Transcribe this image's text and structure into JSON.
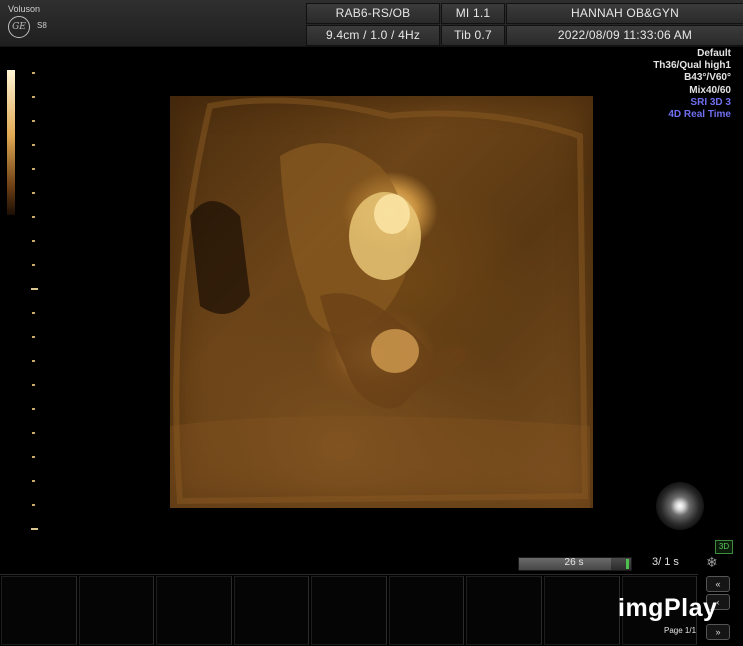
{
  "header": {
    "brand_name": "Voluson",
    "model": "S8",
    "logo_text": "GE",
    "probe": "RAB6-RS/OB",
    "mi": "MI  1.1",
    "institution": "HANNAH OB&GYN",
    "depth_freq": "9.4cm / 1.0 / 4Hz",
    "tib": "Tib  0.7",
    "datetime": "2022/08/09   11:33:06 AM"
  },
  "info_panel": [
    {
      "text": "Default",
      "color": "#e3e3e3"
    },
    {
      "text": "Th36/Qual high1",
      "color": "#e3e3e3"
    },
    {
      "text": "B43°/V60°",
      "color": "#e3e3e3"
    },
    {
      "text": "Mix40/60",
      "color": "#e3e3e3"
    },
    {
      "text": "SRI 3D 3",
      "color": "#6f6ff0"
    },
    {
      "text": "4D Real Time",
      "color": "#6f6ff0"
    }
  ],
  "cine": {
    "time": "26 s",
    "frames": "3/ 1 s",
    "fill_fraction": 0.82
  },
  "badge": "3D",
  "page_label": "Page 1/1",
  "nav_icons": [
    "rewind-icon",
    "back-icon",
    "forward-icon"
  ],
  "watermark": "imgPlay",
  "softkeys": [
    "",
    "",
    "",
    "",
    "",
    "",
    "",
    "",
    ""
  ],
  "colors": {
    "render_tone": "#c28a3f",
    "info_blue": "#6f6ff0",
    "accent_green": "#4cc24c"
  }
}
